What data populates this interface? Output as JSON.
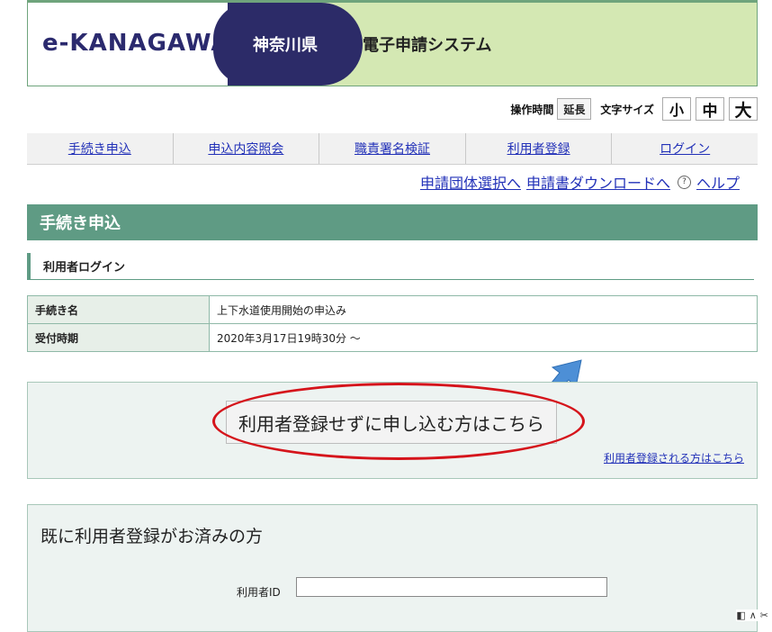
{
  "header": {
    "logo": "e-KANAGAWA",
    "prefecture": "神奈川県",
    "system": "電子申請システム"
  },
  "utility": {
    "time_label": "操作時間",
    "extend_button": "延長",
    "font_size_label": "文字サイズ",
    "size_small": "小",
    "size_medium": "中",
    "size_large": "大"
  },
  "nav": {
    "items": [
      {
        "label": "手続き申込"
      },
      {
        "label": "申込内容照会"
      },
      {
        "label": "職責署名検証"
      },
      {
        "label": "利用者登録"
      },
      {
        "label": "ログイン"
      }
    ]
  },
  "subnav": {
    "group_select": "申請団体選択へ",
    "form_download": "申請書ダウンロードへ",
    "help": "ヘルプ"
  },
  "section": {
    "title": "手続き申込",
    "subtitle": "利用者ログイン"
  },
  "info": {
    "rows": [
      {
        "key": "手続き名",
        "value": "上下水道使用開始の申込み"
      },
      {
        "key": "受付時期",
        "value": "2020年3月17日19時30分 ～"
      }
    ]
  },
  "guest": {
    "button": "利用者登録せずに申し込む方はこちら",
    "register_link": "利用者登録される方はこちら"
  },
  "login": {
    "title": "既に利用者登録がお済みの方",
    "id_label": "利用者ID",
    "id_value": ""
  },
  "colors": {
    "header_bg": "#d4e8b3",
    "pref_tab": "#2c2b68",
    "accent": "#5f9b84",
    "link": "#2231b8",
    "highlight": "#d5141b",
    "arrow": "#4d8fd6"
  }
}
